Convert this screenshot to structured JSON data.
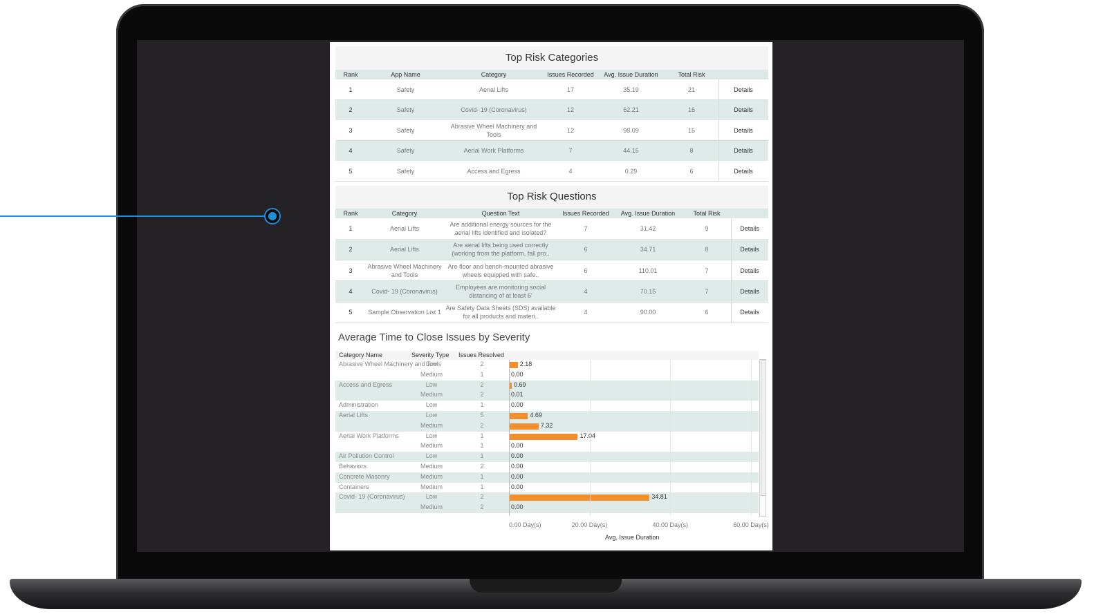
{
  "risk_categories": {
    "title": "Top Risk Categories",
    "headers": [
      "Rank",
      "App Name",
      "Category",
      "Issues Recorded",
      "Avg. Issue Duration",
      "Total Risk"
    ],
    "rows": [
      {
        "rank": "1",
        "app": "Safety",
        "category": "Aerial Lifts",
        "issues": "17",
        "duration": "35.19",
        "risk": "21",
        "details": "Details"
      },
      {
        "rank": "2",
        "app": "Safety",
        "category": "Covid- 19 (Coronavirus)",
        "issues": "12",
        "duration": "62.21",
        "risk": "16",
        "details": "Details"
      },
      {
        "rank": "3",
        "app": "Safety",
        "category": "Abrasive Wheel Machinery and Tools",
        "issues": "12",
        "duration": "98.09",
        "risk": "15",
        "details": "Details"
      },
      {
        "rank": "4",
        "app": "Safety",
        "category": "Aerial Work Platforms",
        "issues": "7",
        "duration": "44.15",
        "risk": "8",
        "details": "Details"
      },
      {
        "rank": "5",
        "app": "Safety",
        "category": "Access and Egress",
        "issues": "4",
        "duration": "0.29",
        "risk": "6",
        "details": "Details"
      }
    ]
  },
  "risk_questions": {
    "title": "Top Risk Questions",
    "headers": [
      "Rank",
      "Category",
      "Question Text",
      "Issues Recorded",
      "Avg. Issue Duration",
      "Total Risk"
    ],
    "rows": [
      {
        "rank": "1",
        "category": "Aerial Lifts",
        "question": "Are additional energy sources for the aerial lifts identified and isolated?",
        "issues": "7",
        "duration": "31.42",
        "risk": "9",
        "details": "Details"
      },
      {
        "rank": "2",
        "category": "Aerial Lifts",
        "question": "Are aerial lifts being used correctly (working from the platform, fall pro..",
        "issues": "6",
        "duration": "34.71",
        "risk": "8",
        "details": "Details"
      },
      {
        "rank": "3",
        "category": "Abrasive Wheel Machinery and Tools",
        "question": "Are floor and bench-mounted abrasive wheels equipped with safe..",
        "issues": "6",
        "duration": "110.01",
        "risk": "7",
        "details": "Details"
      },
      {
        "rank": "4",
        "category": "Covid- 19 (Coronavirus)",
        "question": "Employees are monitoring social distancing of at least 6'",
        "issues": "4",
        "duration": "70.15",
        "risk": "7",
        "details": "Details"
      },
      {
        "rank": "5",
        "category": "Sample Observation List 1",
        "question": "Are Safety Data Sheets (SDS) available for all products and materi..",
        "issues": "4",
        "duration": "90.00",
        "risk": "6",
        "details": "Details"
      }
    ]
  },
  "severity_chart": {
    "title": "Average Time to Close Issues by Severity",
    "headers": {
      "category": "Category Name",
      "severity": "Severity Type",
      "resolved": "Issues Resolved"
    },
    "axis_title": "Avg. Issue Duration",
    "ticks": [
      "0.00 Day(s)",
      "20.00 Day(s)",
      "40.00 Day(s)",
      "60.00 Day(s)"
    ],
    "bar_color": "#f28e2b",
    "row_band_color": "#deebe8"
  },
  "chart_data": {
    "type": "bar",
    "orientation": "horizontal",
    "xlabel": "Avg. Issue Duration",
    "xlim": [
      0,
      60
    ],
    "rows": [
      {
        "category": "Abrasive Wheel Machinery and Tools",
        "severity": "Low",
        "resolved": 2,
        "value": 2.18,
        "label": "2.18"
      },
      {
        "category": "",
        "severity": "Medium",
        "resolved": 1,
        "value": 0.0,
        "label": "0.00"
      },
      {
        "category": "Access and Egress",
        "severity": "Low",
        "resolved": 2,
        "value": 0.69,
        "label": "0.69"
      },
      {
        "category": "",
        "severity": "Medium",
        "resolved": 2,
        "value": 0.01,
        "label": "0.01"
      },
      {
        "category": "Administration",
        "severity": "Low",
        "resolved": 1,
        "value": 0.0,
        "label": "0.00"
      },
      {
        "category": "Aerial Lifts",
        "severity": "Low",
        "resolved": 5,
        "value": 4.69,
        "label": "4.69"
      },
      {
        "category": "",
        "severity": "Medium",
        "resolved": 2,
        "value": 7.32,
        "label": "7.32"
      },
      {
        "category": "Aerial Work Platforms",
        "severity": "Low",
        "resolved": 1,
        "value": 17.04,
        "label": "17.04"
      },
      {
        "category": "",
        "severity": "Medium",
        "resolved": 1,
        "value": 0.0,
        "label": "0.00"
      },
      {
        "category": "Air Pollution Control",
        "severity": "Low",
        "resolved": 1,
        "value": 0.0,
        "label": "0.00"
      },
      {
        "category": "Behaviors",
        "severity": "Medium",
        "resolved": 2,
        "value": 0.0,
        "label": "0.00"
      },
      {
        "category": "Concrete Masonry",
        "severity": "Medium",
        "resolved": 1,
        "value": 0.0,
        "label": "0.00"
      },
      {
        "category": "Containers",
        "severity": "Medium",
        "resolved": 1,
        "value": 0.0,
        "label": "0.00"
      },
      {
        "category": "Covid- 19 (Coronavirus)",
        "severity": "Low",
        "resolved": 2,
        "value": 34.81,
        "label": "34.81"
      },
      {
        "category": "",
        "severity": "Medium",
        "resolved": 2,
        "value": 0.0,
        "label": "0.00"
      }
    ]
  }
}
